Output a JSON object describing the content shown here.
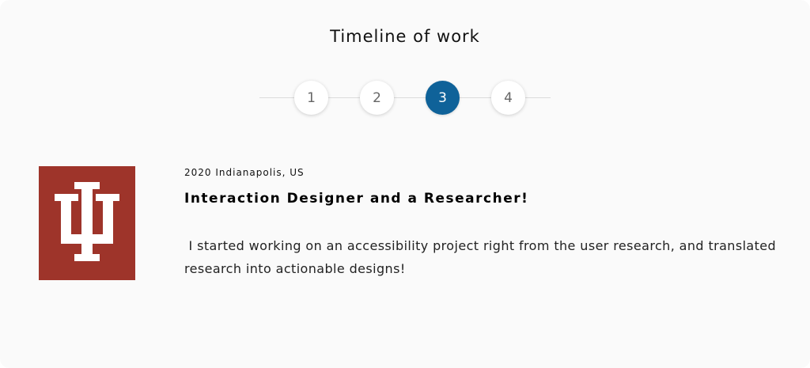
{
  "section": {
    "title": "Timeline of work"
  },
  "timeline": {
    "steps": [
      {
        "label": "1"
      },
      {
        "label": "2"
      },
      {
        "label": "3"
      },
      {
        "label": "4"
      }
    ],
    "active_step": 3
  },
  "entry": {
    "logo_icon": "indiana-university-trident-logo",
    "logo_color": "#9e342a",
    "meta": "2020 Indianapolis, US",
    "role": "Interaction Designer and a Researcher!",
    "description": " I started working on an accessibility project right from the user research, and translated research into actionable designs!"
  },
  "colors": {
    "accent": "#0f6299",
    "background": "#fafafa"
  }
}
